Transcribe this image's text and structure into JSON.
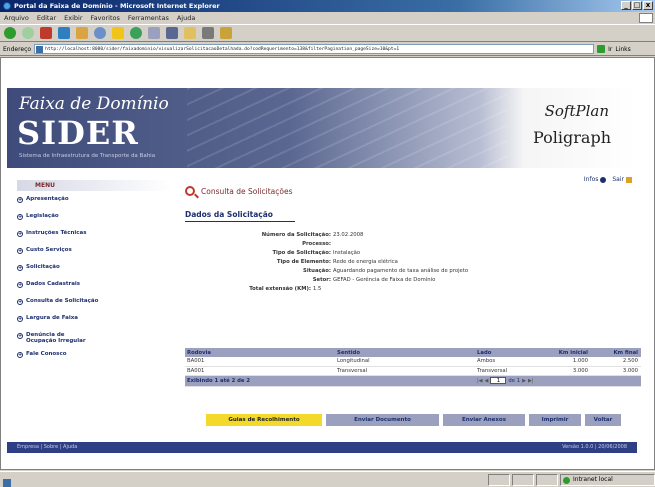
{
  "window": {
    "title": "Portal da Faixa de Domínio - Microsoft Internet Explorer",
    "min": "_",
    "max": "□",
    "close": "x"
  },
  "menu": [
    "Arquivo",
    "Editar",
    "Exibir",
    "Favoritos",
    "Ferramentas",
    "Ajuda"
  ],
  "address": {
    "label": "Endereço",
    "url": "http://localhost:8080/sider/faixadominio/visualizarSolicitacaoDetalhada.do?codRequerimento=138&filterPagination_pageSize=10&pt=1",
    "go_label": "Ir",
    "links_label": "Links"
  },
  "banner": {
    "faixa": "Faixa de Domínio",
    "sider": "SIDER",
    "subtitle": "Sistema de Infraestrutura de Transporte da Bahia",
    "signature": "SoftPlan",
    "poligraph": "Poligraph"
  },
  "sidebar": {
    "title": "MENU",
    "items": [
      {
        "label": "Apresentação"
      },
      {
        "label": "Legislação"
      },
      {
        "label": "Instruções Técnicas"
      },
      {
        "label": "Custo Serviços"
      },
      {
        "label": "Solicitação"
      },
      {
        "label": "Dados Cadastrais"
      },
      {
        "label": "Consulta de Solicitação"
      },
      {
        "label": "Largura de Faixa"
      },
      {
        "label": "Denúncia de Ocupação Irregular"
      },
      {
        "label": "Fale Conosco"
      }
    ]
  },
  "toplinks": {
    "info": "Infos",
    "exit": "Sair"
  },
  "main": {
    "heading": "Consulta de Solicitações",
    "section_title": "Dados da Solicitação",
    "details": [
      {
        "label": "Número da Solicitação:",
        "value": "23.02.2008"
      },
      {
        "label": "Processo:",
        "value": ""
      },
      {
        "label": "Tipo de Solicitação:",
        "value": "Instalação"
      },
      {
        "label": "Tipo de Elemento:",
        "value": "Rede de energia elétrica"
      },
      {
        "label": "Situação:",
        "value": "Aguardando pagamento de taxa análise de projeto"
      },
      {
        "label": "Setor:",
        "value": "GEFAD - Gerência de Faixa de Domínio"
      },
      {
        "label": "Total extensão (KM):",
        "value": "1.5"
      }
    ]
  },
  "table": {
    "headers": [
      "Rodovia",
      "Sentido",
      "Lado",
      "Km inicial",
      "Km final"
    ],
    "rows": [
      [
        "BA001",
        "Longitudinal",
        "Ambos",
        "1.000",
        "2.500"
      ],
      [
        "BA001",
        "Transversal",
        "Transversal",
        "3.000",
        "3.000"
      ]
    ],
    "footer_count": "Exibindo 1 até 2 de 2",
    "pager_value": "1",
    "pager_of": "de 1"
  },
  "buttons": {
    "taxes": "Guias de Recolhimento",
    "docs": "Enviar Documento",
    "attachments": "Enviar Anexos",
    "print": "Imprimir",
    "back": "Voltar"
  },
  "footer": {
    "left": "Empresa | Sobre | Ajuda",
    "right": "Versão 1.0.0 | 20/06/2008"
  },
  "status": {
    "main": "",
    "zone": "Intranet local"
  },
  "colors": {
    "nav_blue": "#1c2f6e",
    "accent_red": "#7a2a2a",
    "header_gray": "#9aa0bd",
    "yellow": "#f2d92a"
  }
}
